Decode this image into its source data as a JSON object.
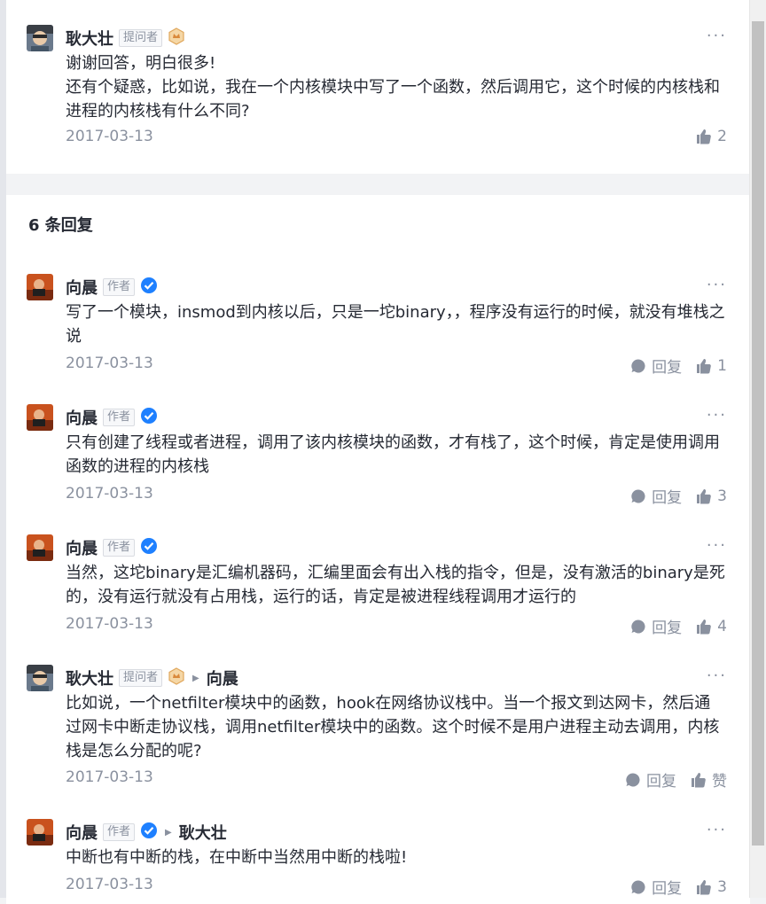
{
  "original_post": {
    "author": "耿大壮",
    "badge": "提问者",
    "more": "···",
    "content": "谢谢回答，明白很多!\n还有个疑惑，比如说，我在一个内核模块中写了一个函数，然后调用它，这个时候的内核栈和进程的内核栈有什么不同?",
    "date": "2017-03-13",
    "likes": "2"
  },
  "replies_header": "6 条回复",
  "replies": [
    {
      "author": "向晨",
      "badge": "作者",
      "more": "···",
      "content": "写了一个模块，insmod到内核以后，只是一坨binary，，程序没有运行的时候，就没有堆栈之说",
      "date": "2017-03-13",
      "reply_label": "回复",
      "likes": "1"
    },
    {
      "author": "向晨",
      "badge": "作者",
      "more": "···",
      "content": "只有创建了线程或者进程，调用了该内核模块的函数，才有栈了，这个时候，肯定是使用调用函数的进程的内核栈",
      "date": "2017-03-13",
      "reply_label": "回复",
      "likes": "3"
    },
    {
      "author": "向晨",
      "badge": "作者",
      "more": "···",
      "content": "当然，这坨binary是汇编机器码，汇编里面会有出入栈的指令，但是，没有激活的binary是死的，没有运行就没有占用栈，运行的话，肯定是被进程线程调用才运行的",
      "date": "2017-03-13",
      "reply_label": "回复",
      "likes": "4"
    },
    {
      "author": "耿大壮",
      "badge": "提问者",
      "reply_to": "向晨",
      "more": "···",
      "content": "比如说，一个netfilter模块中的函数，hook在网络协议栈中。当一个报文到达网卡，然后通过网卡中断走协议栈，调用netfilter模块中的函数。这个时候不是用户进程主动去调用，内核栈是怎么分配的呢?",
      "date": "2017-03-13",
      "reply_label": "回复",
      "likes": "赞"
    },
    {
      "author": "向晨",
      "badge": "作者",
      "reply_to": "耿大壮",
      "more": "···",
      "content": "中断也有中断的栈，在中断中当然用中断的栈啦!",
      "date": "2017-03-13",
      "reply_label": "回复",
      "likes": "3"
    }
  ]
}
